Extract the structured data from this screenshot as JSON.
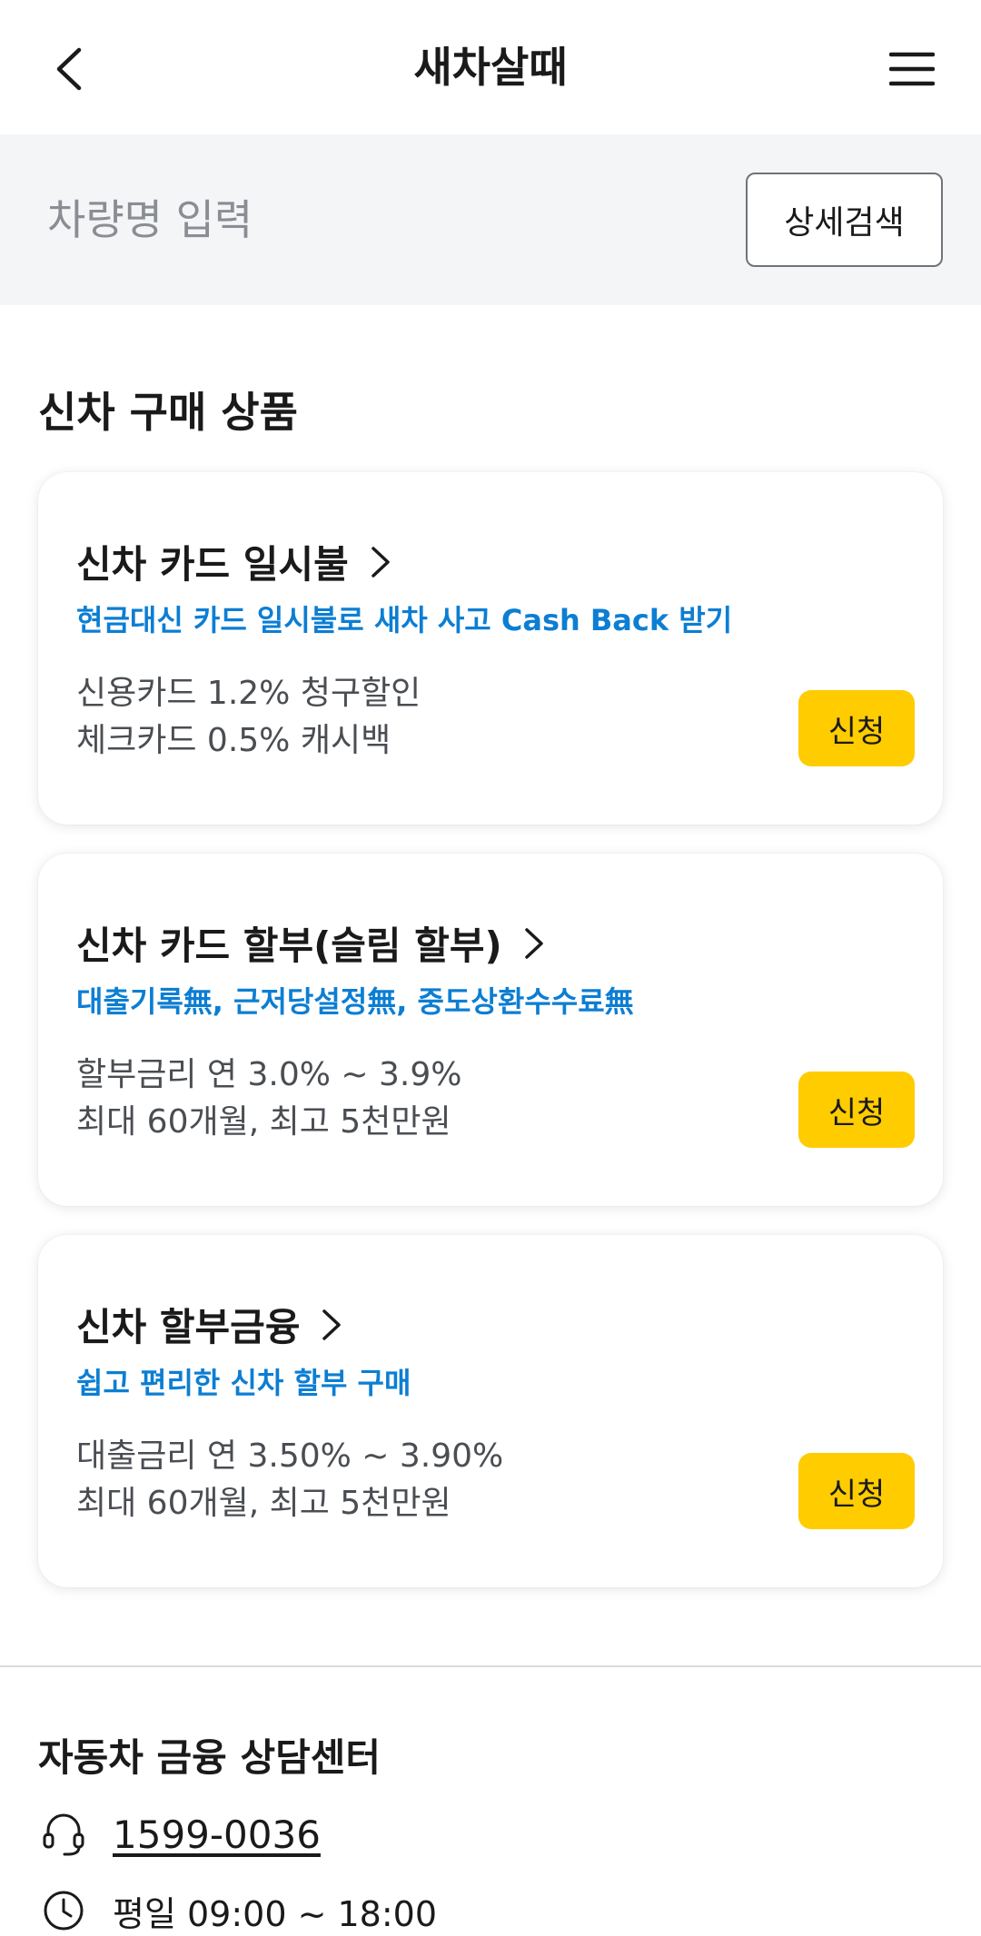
{
  "header": {
    "title": "새차살때",
    "back_icon": "chevron-left-icon",
    "menu_icon": "hamburger-menu-icon"
  },
  "search": {
    "placeholder": "차량명 입력",
    "value": "",
    "detail_button_label": "상세검색"
  },
  "section": {
    "title": "신차 구매 상품"
  },
  "products": [
    {
      "title": "신차 카드 일시불",
      "subtitle": "현금대신 카드 일시불로 새차 사고 Cash Back 받기",
      "desc_line1": "신용카드 1.2% 청구할인",
      "desc_line2": "체크카드 0.5% 캐시백",
      "apply_label": "신청"
    },
    {
      "title": "신차 카드 할부(슬림 할부)",
      "subtitle": "대출기록無, 근저당설정無, 중도상환수수료無",
      "desc_line1": "할부금리 연 3.0% ~ 3.9%",
      "desc_line2": "최대 60개월, 최고 5천만원",
      "apply_label": "신청"
    },
    {
      "title": "신차 할부금융",
      "subtitle": "쉽고 편리한 신차 할부 구매",
      "desc_line1": "대출금리 연 3.50% ~ 3.90%",
      "desc_line2": "최대 60개월, 최고 5천만원",
      "apply_label": "신청"
    }
  ],
  "consult_center": {
    "title": "자동차 금융 상담센터",
    "phone": "1599-0036",
    "hours": "평일 09:00 ~ 18:00",
    "phone_icon": "headset-icon",
    "hours_icon": "clock-icon"
  },
  "colors": {
    "accent_yellow": "#ffcc00",
    "link_blue": "#0c7ed3",
    "search_bg": "#f4f5f7"
  }
}
